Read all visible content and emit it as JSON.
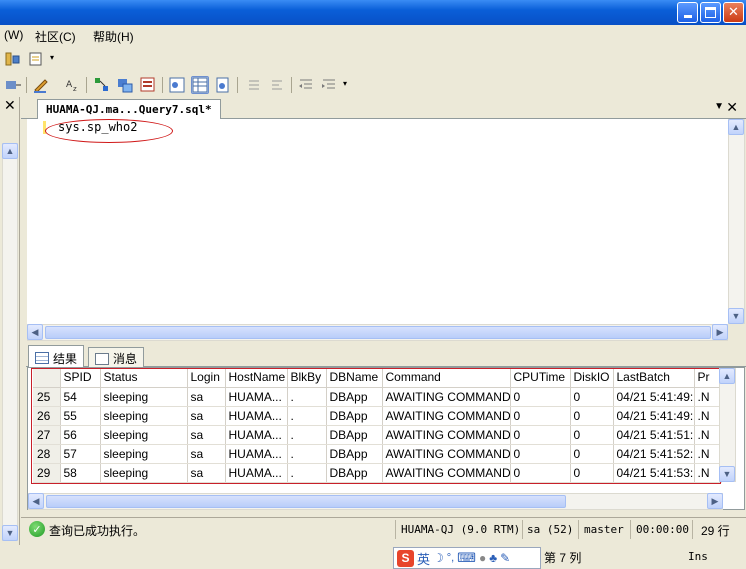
{
  "window": {
    "minimize_glyph": "",
    "close_glyph": "✕"
  },
  "menu": {
    "items": [
      "(W)",
      "社区(C)",
      "帮助(H)"
    ]
  },
  "document": {
    "tab_title": "HUAMA-QJ.ma...Query7.sql*",
    "close_glyph": "✕",
    "dropdown_glyph": "▼",
    "editor_text": "sys.sp_who2"
  },
  "results": {
    "tabs": [
      {
        "label": "结果"
      },
      {
        "label": "消息"
      }
    ],
    "columns": [
      "",
      "SPID",
      "Status",
      "Login",
      "HostName",
      "BlkBy",
      "DBName",
      "Command",
      "CPUTime",
      "DiskIO",
      "LastBatch",
      "Pr"
    ],
    "rows": [
      [
        "25",
        "54",
        "sleeping",
        "sa",
        "HUAMA...",
        ".",
        "DBApp",
        "AWAITING COMMAND",
        "0",
        "0",
        "04/21 5:41:49:",
        ".N"
      ],
      [
        "26",
        "55",
        "sleeping",
        "sa",
        "HUAMA...",
        ".",
        "DBApp",
        "AWAITING COMMAND",
        "0",
        "0",
        "04/21 5:41:49:",
        ".N"
      ],
      [
        "27",
        "56",
        "sleeping",
        "sa",
        "HUAMA...",
        ".",
        "DBApp",
        "AWAITING COMMAND",
        "0",
        "0",
        "04/21 5:41:51:",
        ".N"
      ],
      [
        "28",
        "57",
        "sleeping",
        "sa",
        "HUAMA...",
        ".",
        "DBApp",
        "AWAITING COMMAND",
        "0",
        "0",
        "04/21 5:41:52:",
        ".N"
      ],
      [
        "29",
        "58",
        "sleeping",
        "sa",
        "HUAMA...",
        ".",
        "DBApp",
        "AWAITING COMMAND",
        "0",
        "0",
        "04/21 5:41:53:",
        ".N"
      ]
    ]
  },
  "status": {
    "message": "查询已成功执行。",
    "server": "HUAMA-QJ (9.0 RTM)",
    "user": "sa (52)",
    "database": "master",
    "elapsed": "00:00:00",
    "row_count": "29 行"
  },
  "bottom": {
    "ime_logo": "S",
    "ime_mode": "英",
    "position_text": "第 7 列",
    "ins": "Ins"
  },
  "colors": {
    "annotation_red": "#d01818",
    "title_blue": "#0a5fd8",
    "success_green": "#1f9a24"
  }
}
